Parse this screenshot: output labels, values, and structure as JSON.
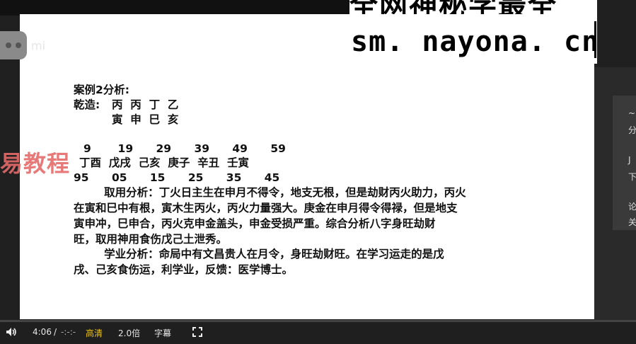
{
  "watermark": {
    "line1": "全网神秘学最全",
    "site": "sm. nayona. cn",
    "red_text": "易教程",
    "faint_text": "mi"
  },
  "slide": {
    "title": "案例2分析:",
    "qianzao_label": "乾造:",
    "stems": "丙  丙  丁  乙",
    "branches": "寅  申  巳  亥",
    "ages": "9       19      29      39      49      59",
    "dayun": "丁酉  戊戌  己亥  庚子  辛丑  壬寅",
    "years": "95      05      15      25      35      45",
    "para1": [
      "        取用分析：丁火日主生在申月不得令，地支无根，但是劫财丙火助力，丙火",
      "在寅和巳中有根，寅木生丙火，丙火力量强大。庚金在申月得令得禄，但是地支",
      "寅申冲，巳申合，丙火克申金盖头，申金受损严重。综合分析八字身旺劫财",
      "旺，取用神用食伤戊己土泄秀。"
    ],
    "para2": [
      "        学业分析：命局中有文昌贵人在月令，身旺劫财旺。在学习运走的是戊",
      "戌、己亥食伤运，利学业，反馈：医学博士。"
    ]
  },
  "side_panel": {
    "items": [
      "~",
      "分",
      "J",
      "下",
      "论",
      "关"
    ]
  },
  "player": {
    "time": "4:06",
    "separator": "/",
    "duration": "-:-:-",
    "quality": "高清",
    "speed": "2.0倍",
    "subtitle": "字幕",
    "progress": 0.0,
    "accent": "#e23a3a",
    "volume_icon": "volume-icon",
    "fullscreen_icon": "fullscreen-icon"
  }
}
